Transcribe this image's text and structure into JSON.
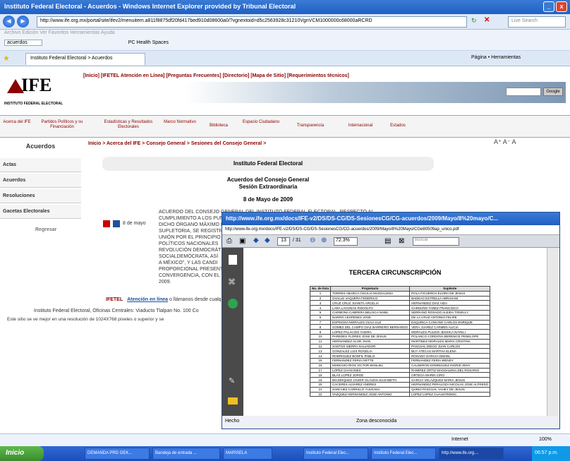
{
  "browser": {
    "title": "Instituto Federal Electoral - Acuerdos - Windows Internet Explorer provided by Tribunal Electoral",
    "url": "http://www.ife.org.mx/portal/site/ifev2/menuitem.a811f8875df20fd417bed910d08600a0/?vgnextoid=d5c2563928c31210VgnVCM1000000c68000aRCRD",
    "search_placeholder": "Live Search",
    "menu": "Archivo  Edición  Ver  Favoritos  Herramientas  Ayuda",
    "search_term": "acuerdos",
    "toolbar": "PC Health   Spaces",
    "tab": "Instituto Federal Electoral > Acuerdos",
    "right_tools": "Página  •  Herramientas"
  },
  "site": {
    "logo": "IFE",
    "logo_sub": "INSTITUTO FEDERAL ELECTORAL",
    "toplinks": "[Inicio]  [IFETEL Atención en Línea]  [Preguntas Frecuentes]  [Directorio]  [Mapa de Sitio]  [Requerimientos técnicos]",
    "search_btn": "Google",
    "nav": [
      "Acerca del IFE",
      "Partidos Políticos y su Financiación",
      "Estadísticas y Resultados Electorales",
      "Marco Normativo",
      "Biblioteca",
      "Espacio Ciudadano",
      "Transparencia",
      "Internacional",
      "Estados"
    ],
    "left_head": "Acuerdos",
    "left_items": [
      "Actas",
      "Acuerdos",
      "Resoluciones",
      "Gacetas Electorales"
    ],
    "back": "Regresar",
    "breadcrumb": "Inicio > Acerca del IFE > Consejo General > Sesiones del Consejo General >",
    "tools": "A⁺  A⁻  A",
    "inst": "Instituto Federal Electoral",
    "acuerdos": "Acuerdos del Consejo General",
    "sesion": "Sesión Extraordinaria",
    "fecha": "8 de Mayo de 2009",
    "doc_date": "8 de mayo",
    "body": "ACUERDO DEL CONSEJO GENERAL DEL INSTITUTO FEDERAL ELECTORAL, RESPECTO AL\nCUMPLIMIENTO A LOS PUNTOS SÉPTIMO, OCTAVO, NOVENO Y DÉCIMO DEL ACUERDO DE\nDICHO ÓRGANO MÁXIMO DE DIRECCIÓN, POR EL QUE, EN EJERCICIO DE LA FACULTAD\nSUPLETORIA, SE REGISTR\nUNIÓN POR EL PRINCIPIO\nPOLÍTICOS NACIONALES\nREVOLUCIÓN DEMOCRÁT\nSOCIALDEMÓCRATA, ASÍ\nA MÉXICO\", Y LAS CANDI\nPROPORCIONAL PRESENT\nCONVERGENCIA, CON EL\n2009.",
    "ifetel": "IFETEL",
    "ifetel_link": "Atención en línea",
    "ifetel_rest": "o llámanos desde cualq",
    "footer": "Instituto Federal Electoral, Oficinas Centrales: Viaducto Tlalpan No. 100 Co",
    "footer2": "Este sitio se ve mejor en una resolución de 1024X768 píxeles o superior y se"
  },
  "pdf": {
    "title": "http://www.ife.org.mx/docs/IFE-v2/DS/DS-CG/DS-SesionesCG/CG-acuerdos/2009/Mayo/8%20mayo/C...",
    "url": "http://www.ife.org.mx/docs/IFE-v2/DS/DS-CG/DS-SesionesCG/CG-acuerdos/2009/Mayo/8%20Mayo/CGe80509ap_unico.pdf",
    "page": "13",
    "pages": "/ 31",
    "zoom": "72.3%",
    "find": "Buscar",
    "heading": "TERCERA CIRCUNSCRIPCIÓN",
    "cols": [
      "No. de lista",
      "Propietario",
      "Suplente"
    ],
    "rows": [
      [
        "1",
        "TORRES ABARCA OSCILIA MAGDALENA",
        "POLA FIGUEROA ELVIRA DE JESUS"
      ],
      [
        "2",
        "OVALLE VAQUERA FEDERICO",
        "BADEAO ESTRELLA ABRAHAM"
      ],
      [
        "3",
        "CRUZ CRUZ JUANITA ARCELIA",
        "HERNANDEZ DIAZ AIDA"
      ],
      [
        "4",
        "LARA LAGUNAS RODOLFO",
        "GARDUÑO YAÑEZ FRANCISCO"
      ],
      [
        "5",
        "CARMONA CABRERA BELISCA NABIL",
        "SERRANO ROSADO ALEIDA TONELLY"
      ],
      [
        "6",
        "NARRO CESPEDES JOSE",
        "DE LA CRUZ ANTONIO FELIPE"
      ],
      [
        "7",
        "ESPINOSA MORALES OLGA LUZ",
        "ESQUINCA CANCINO CARLOS ENRIQUE"
      ],
      [
        "8",
        "GOMEZ DEL CAMPO DIAZ BARREIRO BERNARDO",
        "VERA JUAREZ CARMEN ALICIA"
      ],
      [
        "9",
        "LOPEZ PALACIOS YADIRA",
        "MORALES PULIDO JESSICA NAYELI"
      ],
      [
        "10",
        "PAREDES FLORES JOSE DE JESUS",
        "POLANCO CORDOVA BERENICE PENELOPE"
      ],
      [
        "11",
        "HERNANDEZ ALOR JHAN",
        "MARTINEZ MORALES MARIA CRISTINA"
      ],
      [
        "12",
        "SANTOS SIERRA SALVADOR",
        "PASCUAL DIEGO JUAN CARLOS"
      ],
      [
        "13",
        "GONZALEZ LUIS ROGELIA",
        "BUY ATECAS MARTHA ELENA"
      ],
      [
        "14",
        "RODRIGUEZ BONFIL PABLO",
        "ROSADO GARCIA ISMAEL"
      ],
      [
        "15",
        "FERNANDEZ FERIA IVETTE",
        "FERNANDEZ FERIA WENDY"
      ],
      [
        "16",
        "MUNGUIO RIOS VICTOR MANUEL",
        "CALDERON DOMINGUEZ INGRID JENY"
      ],
      [
        "17",
        "LOPEZ CHAN INES",
        "RAMIREZ ORTIZ MAGDALENA DEL ROSARIO"
      ],
      [
        "18",
        "BLAS LOPEZ JORGE",
        "ORTEGA MARIN CIRO"
      ],
      [
        "19",
        "BOJORQUEZ JAVIER OLAUDIA ELIZABETH",
        "GARCIA VELAZQUEZ MARIA JESUS"
      ],
      [
        "20",
        "CACERES ALVAREZ ANDRES",
        "HERNANDEZ PERALOZA NICOLAS JOSE ALFREDO"
      ],
      [
        "21",
        "SANCHEZ CARRILLO YULEANA",
        "QUINO PASCUAL YAHEY DE JESUS"
      ],
      [
        "22",
        "VAZQUEZ HERNANDEZ JOSE ANTONIO",
        "LOPEZ LOPEZ CUAUHTEMOC"
      ]
    ],
    "status_left": "Hecho",
    "status_mid": "Zona desconocida"
  },
  "status": {
    "right": "Internet",
    "zoom": "100%"
  },
  "taskbar": {
    "start": "Inicio",
    "tasks": [
      "DEMANDA PRD GEK...",
      "Bandeja de entrada ...",
      "MARISELA",
      "Instituto Federal Elec...",
      "Instituto Federal Elec...",
      "http://www.ife.org...."
    ],
    "clock": "06:57 p.m."
  }
}
